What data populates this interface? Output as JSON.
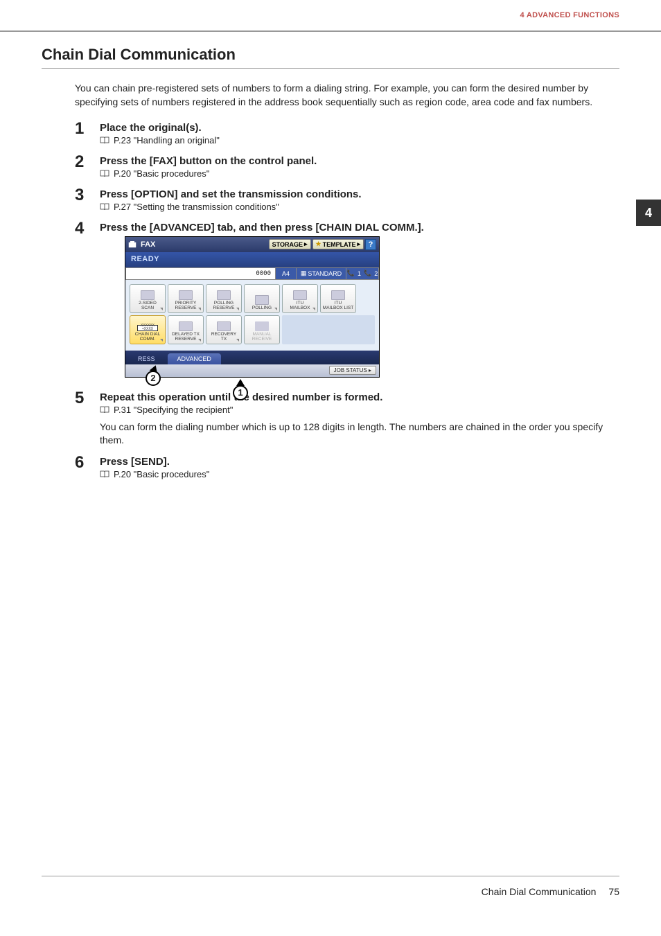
{
  "header": {
    "breadcrumb": "4 ADVANCED FUNCTIONS"
  },
  "side_tab": "4",
  "title": "Chain Dial Communication",
  "intro": "You can chain pre-registered sets of numbers to form a dialing string. For example, you can form the desired number by specifying sets of numbers registered in the address book sequentially such as region code, area code and fax numbers.",
  "steps": [
    {
      "num": "1",
      "title": "Place the original(s).",
      "ref": "P.23 \"Handling an original\""
    },
    {
      "num": "2",
      "title": "Press the [FAX] button on the control panel.",
      "ref": "P.20 \"Basic procedures\""
    },
    {
      "num": "3",
      "title": "Press [OPTION] and set the transmission conditions.",
      "ref": "P.27 \"Setting the transmission conditions\""
    },
    {
      "num": "4",
      "title": "Press the [ADVANCED] tab, and then press [CHAIN DIAL COMM.]."
    },
    {
      "num": "5",
      "title": "Repeat this operation until the desired number is formed.",
      "ref": "P.31 \"Specifying the recipient\"",
      "note": "You can form the dialing number which is up to 128 digits in length. The numbers are chained in the order you specify them."
    },
    {
      "num": "6",
      "title": "Press [SEND].",
      "ref": "P.20 \"Basic procedures\""
    }
  ],
  "panel": {
    "title": "FAX",
    "storage_btn": "STORAGE",
    "template_btn": "TEMPLATE",
    "help": "?",
    "ready": "READY",
    "counter": "0000",
    "paper": "A4",
    "standard": "STANDARD",
    "line1": "1",
    "line2": "2",
    "buttons_row1": [
      "2-SIDED\nSCAN",
      "PRIORITY\nRESERVE",
      "POLLING\nRESERVE",
      "POLLING",
      "ITU\nMAILBOX",
      "ITU\nMAILBOX LIST"
    ],
    "buttons_row2": [
      "CHAIN DIAL\nCOMM.",
      "DELAYED TX\nRESERVE",
      "RECOVERY\nTX",
      "MANUAL\nRECEIVE"
    ],
    "chain_label": "XXXXXX\n+XXXX",
    "tabs": {
      "address": "RESS",
      "advanced": "ADVANCED"
    },
    "job_status": "JOB STATUS",
    "callout1": "1",
    "callout2": "2"
  },
  "footer": {
    "title": "Chain Dial Communication",
    "page": "75"
  }
}
